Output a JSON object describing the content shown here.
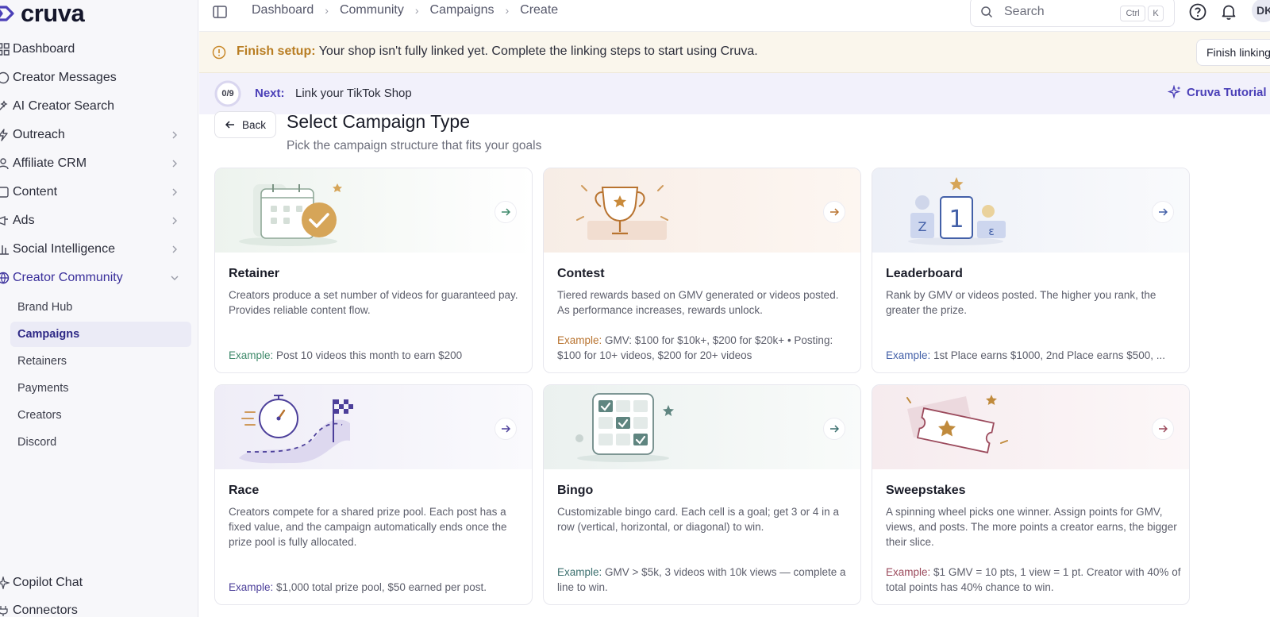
{
  "brand": {
    "name": "cruva"
  },
  "sidebar": {
    "items": [
      {
        "label": "Dashboard",
        "icon": "grid-icon"
      },
      {
        "label": "Creator Messages",
        "icon": "message-icon"
      },
      {
        "label": "AI Creator Search",
        "icon": "sparkle-search-icon"
      },
      {
        "label": "Outreach",
        "icon": "megaphone-icon"
      },
      {
        "label": "Affiliate CRM",
        "icon": "users-icon"
      },
      {
        "label": "Content",
        "icon": "image-icon"
      },
      {
        "label": "Ads",
        "icon": "ads-icon"
      },
      {
        "label": "Social Intelligence",
        "icon": "bar-chart-icon"
      },
      {
        "label": "Creator Community",
        "icon": "globe-icon"
      }
    ],
    "community_sub": [
      "Brand Hub",
      "Campaigns",
      "Retainers",
      "Payments",
      "Creators",
      "Discord"
    ],
    "bottom": [
      {
        "label": "Copilot Chat",
        "icon": "copilot-icon"
      },
      {
        "label": "Connectors",
        "icon": "plug-icon"
      }
    ]
  },
  "header": {
    "breadcrumb": [
      "Dashboard",
      "Community",
      "Campaigns",
      "Create"
    ],
    "search_placeholder": "Search",
    "shortcut_ctrl": "Ctrl",
    "shortcut_key": "K",
    "avatar_initials": "DK"
  },
  "setup_banner": {
    "label": "Finish setup:",
    "message": "Your shop isn't fully linked yet. Complete the linking steps to start using Cruva.",
    "button": "Finish linking"
  },
  "next_banner": {
    "progress": "0/9",
    "progress_fraction": 0,
    "next_label": "Next:",
    "step": "Link your TikTok Shop",
    "tutorial": "Cruva Tutorial"
  },
  "page": {
    "back": "Back",
    "title": "Select Campaign Type",
    "subtitle": "Pick the campaign structure that fits your goals"
  },
  "cards": [
    {
      "title": "Retainer",
      "description": "Creators produce a set number of videos for guaranteed pay. Provides reliable content flow.",
      "example_label": "Example:",
      "example": "Post 10 videos this month to earn $200",
      "accent": "#3f8a6b"
    },
    {
      "title": "Contest",
      "description": "Tiered rewards based on GMV generated or videos posted. As performance increases, rewards unlock.",
      "example_label": "Example:",
      "example": "GMV: $100 for $10k+, $200 for $20k+ • Posting: $100 for 10+ videos, $200 for 20+ videos",
      "accent": "#b8732f"
    },
    {
      "title": "Leaderboard",
      "description": "Rank by GMV or videos posted. The higher you rank, the greater the prize.",
      "example_label": "Example:",
      "example": "1st Place earns $1000, 2nd Place earns $500, ...",
      "accent": "#4360a8"
    },
    {
      "title": "Race",
      "description": "Creators compete for a shared prize pool. Each post has a fixed value, and the campaign automatically ends once the prize pool is fully allocated.",
      "example_label": "Example:",
      "example": "$1,000 total prize pool, $50 earned per post.",
      "accent": "#4c3f9a"
    },
    {
      "title": "Bingo",
      "description": "Customizable bingo card. Each cell is a goal; get 3 or 4 in a row (vertical, horizontal, or diagonal) to win.",
      "example_label": "Example:",
      "example": "GMV > $5k, 3 videos with 10k views — complete a line to win.",
      "accent": "#3b6f6e"
    },
    {
      "title": "Sweepstakes",
      "description": "A spinning wheel picks one winner. Assign points for GMV, views, and posts. The more points a creator earns, the bigger their slice.",
      "example_label": "Example:",
      "example": "$1 GMV = 10 pts, 1 view = 1 pt. Creator with 40% of total points has 40% chance to win.",
      "accent": "#9b4a5c"
    }
  ]
}
